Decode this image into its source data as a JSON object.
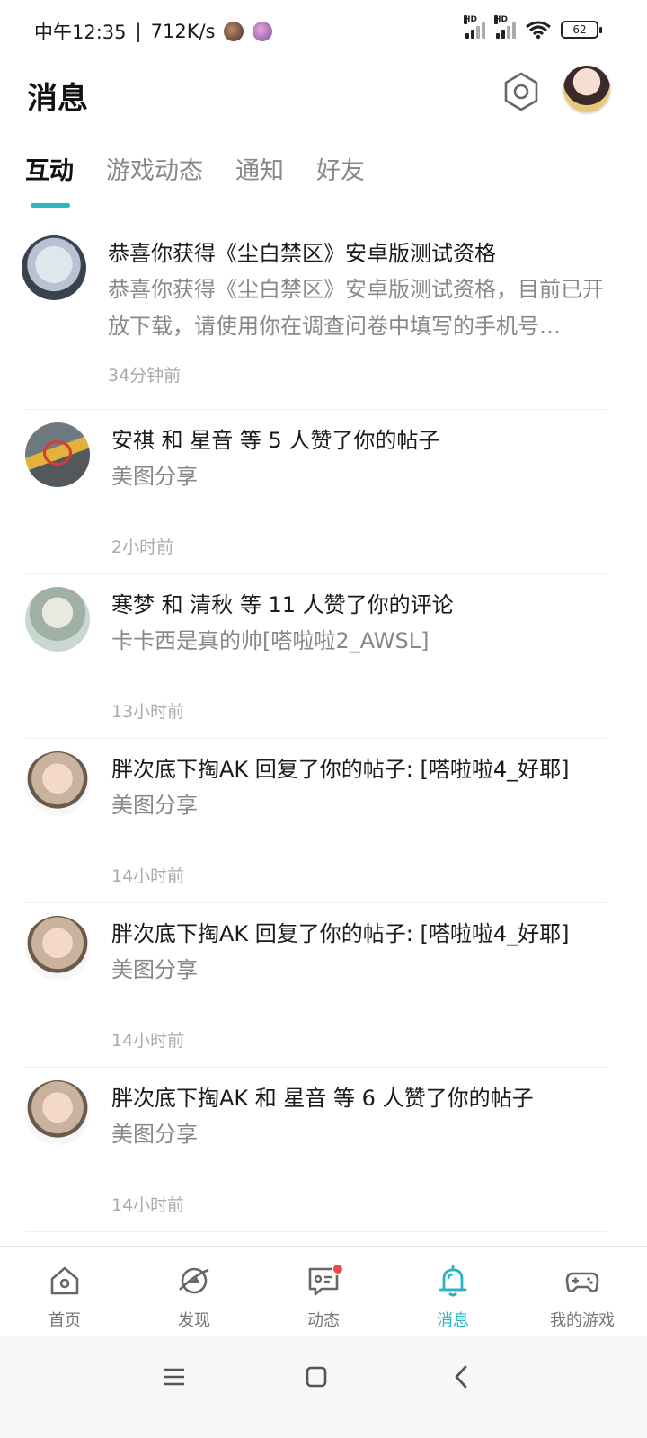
{
  "status_bar": {
    "time": "中午12:35",
    "speed": "712K/s",
    "signal1_hd": "HD",
    "signal2_hd": "HD",
    "battery": "62"
  },
  "header": {
    "title": "消息"
  },
  "tabs": [
    {
      "label": "互动",
      "active": true
    },
    {
      "label": "游戏动态",
      "active": false
    },
    {
      "label": "通知",
      "active": false
    },
    {
      "label": "好友",
      "active": false
    }
  ],
  "messages": [
    {
      "title": "恭喜你获得《尘白禁区》安卓版测试资格",
      "desc": "恭喜你获得《尘白禁区》安卓版测试资格，目前已开放下载，请使用你在调查问卷中填写的手机号…",
      "time": "34分钟前"
    },
    {
      "title": "安祺 和 星音 等 5 人赞了你的帖子",
      "desc": "美图分享",
      "time": "2小时前"
    },
    {
      "title": "寒梦 和 清秋 等 11 人赞了你的评论",
      "desc": "卡卡西是真的帅[嗒啦啦2_AWSL]",
      "time": "13小时前"
    },
    {
      "title": "胖次底下掏AK 回复了你的帖子: [嗒啦啦4_好耶]",
      "desc": "美图分享",
      "time": "14小时前"
    },
    {
      "title": "胖次底下掏AK 回复了你的帖子: [嗒啦啦4_好耶]",
      "desc": "美图分享",
      "time": "14小时前"
    },
    {
      "title": "胖次底下掏AK 和 星音 等 6 人赞了你的帖子",
      "desc": "美图分享",
      "time": "14小时前"
    }
  ],
  "bottom_nav": [
    {
      "label": "首页",
      "icon": "home-icon"
    },
    {
      "label": "发现",
      "icon": "discover-icon"
    },
    {
      "label": "动态",
      "icon": "feed-icon",
      "badge": true
    },
    {
      "label": "消息",
      "icon": "bell-icon",
      "active": true
    },
    {
      "label": "我的游戏",
      "icon": "gamepad-icon"
    }
  ],
  "colors": {
    "accent": "#2bb5c3",
    "badge": "#f04848"
  }
}
